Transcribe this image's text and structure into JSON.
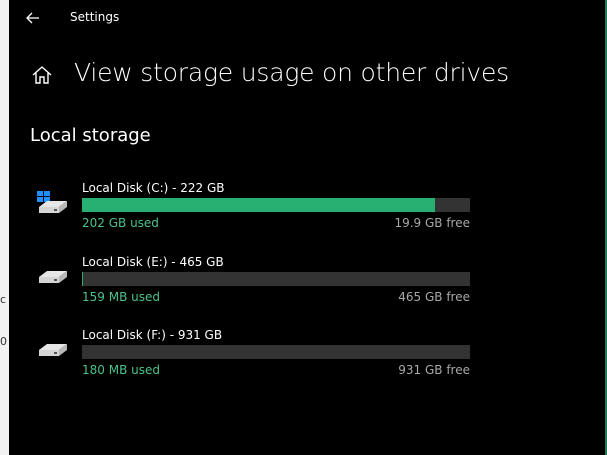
{
  "window": {
    "title": "Settings"
  },
  "page": {
    "title": "View storage usage on other drives",
    "section_title": "Local storage"
  },
  "drives": [
    {
      "name": "Local Disk (C:) - 222 GB",
      "used": "202 GB used",
      "free": "19.9 GB free",
      "used_fraction": 0.91,
      "icon": "windows-system-drive-icon"
    },
    {
      "name": "Local Disk (E:) - 465 GB",
      "used": "159 MB used",
      "free": "465 GB free",
      "used_fraction": 0.0003,
      "icon": "hard-drive-icon"
    },
    {
      "name": "Local Disk (F:) - 931 GB",
      "used": "180 MB used",
      "free": "931 GB free",
      "used_fraction": 0.0002,
      "icon": "hard-drive-icon"
    }
  ],
  "colors": {
    "background": "#000000",
    "accent_bar": "#27b072",
    "used_text": "#4cc38a",
    "track": "#333333"
  },
  "background_window": {
    "fragments": [
      "c",
      "0"
    ]
  }
}
